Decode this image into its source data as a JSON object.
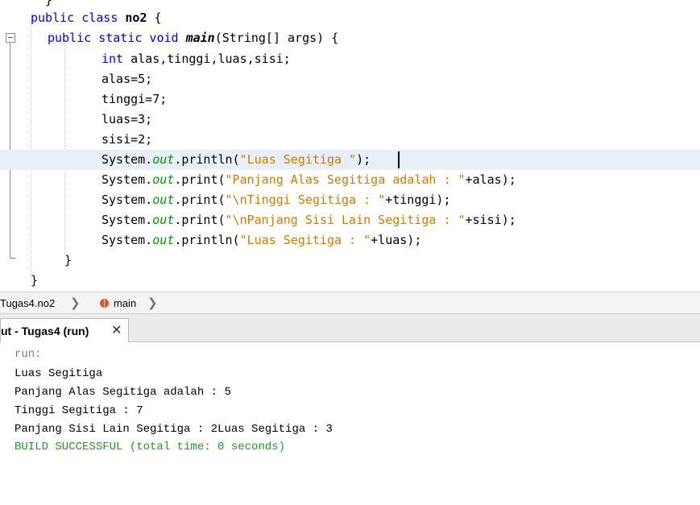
{
  "editor": {
    "lines": [
      [
        {
          "t": "  }",
          "c": ""
        }
      ],
      [
        {
          "t": "public class ",
          "c": "kw"
        },
        {
          "t": "no2",
          "c": "bold"
        },
        {
          "t": " {",
          "c": ""
        }
      ],
      [
        {
          "t": "public static void ",
          "c": "kw"
        },
        {
          "t": "main",
          "c": "mth"
        },
        {
          "t": "(String[] args) {",
          "c": ""
        }
      ],
      [
        {
          "t": "int ",
          "c": "kw"
        },
        {
          "t": "alas,tinggi,luas,sisi;",
          "c": ""
        }
      ],
      [
        {
          "t": "alas=5;",
          "c": ""
        }
      ],
      [
        {
          "t": "tinggi=7;",
          "c": ""
        }
      ],
      [
        {
          "t": "luas=3;",
          "c": ""
        }
      ],
      [
        {
          "t": "sisi=2;",
          "c": ""
        }
      ],
      [
        {
          "t": "System.",
          "c": ""
        },
        {
          "t": "out",
          "c": "fld"
        },
        {
          "t": ".println(",
          "c": ""
        },
        {
          "t": "\"Luas Segitiga \"",
          "c": "str"
        },
        {
          "t": ");",
          "c": ""
        }
      ],
      [
        {
          "t": "System.",
          "c": ""
        },
        {
          "t": "out",
          "c": "fld"
        },
        {
          "t": ".print(",
          "c": ""
        },
        {
          "t": "\"Panjang Alas Segitiga adalah : \"",
          "c": "str"
        },
        {
          "t": "+alas);",
          "c": ""
        }
      ],
      [
        {
          "t": "System.",
          "c": ""
        },
        {
          "t": "out",
          "c": "fld"
        },
        {
          "t": ".print(",
          "c": ""
        },
        {
          "t": "\"\\nTinggi Segitiga : \"",
          "c": "str"
        },
        {
          "t": "+tinggi);",
          "c": ""
        }
      ],
      [
        {
          "t": "System.",
          "c": ""
        },
        {
          "t": "out",
          "c": "fld"
        },
        {
          "t": ".print(",
          "c": ""
        },
        {
          "t": "\"\\nPanjang Sisi Lain Segitiga : \"",
          "c": "str"
        },
        {
          "t": "+sisi);",
          "c": ""
        }
      ],
      [
        {
          "t": "System.",
          "c": ""
        },
        {
          "t": "out",
          "c": "fld"
        },
        {
          "t": ".println(",
          "c": ""
        },
        {
          "t": "\"Luas Segitiga : \"",
          "c": "str"
        },
        {
          "t": "+luas);",
          "c": ""
        }
      ],
      [
        {
          "t": "}",
          "c": ""
        }
      ],
      [
        {
          "t": "}",
          "c": ""
        }
      ]
    ],
    "fold_marker": "−"
  },
  "breadcrumb": {
    "class_label": "Tugas4.no2",
    "method_label": "main",
    "separator": "❯"
  },
  "output_tab": {
    "label": "ut - Tugas4 (run)",
    "close": "✕"
  },
  "output": {
    "lines": [
      {
        "text": "run:",
        "style": "muted"
      },
      {
        "text": "Luas Segitiga",
        "style": ""
      },
      {
        "text": "Panjang Alas Segitiga adalah : 5",
        "style": ""
      },
      {
        "text": "Tinggi Segitiga : 7",
        "style": ""
      },
      {
        "text": "Panjang Sisi Lain Segitiga : 2Luas Segitiga : 3",
        "style": ""
      },
      {
        "text": "BUILD SUCCESSFUL (total time: 0 seconds)",
        "style": "success"
      }
    ]
  },
  "colors": {
    "keyword": "#0000e6",
    "string": "#ce7b00",
    "field": "#009900",
    "success": "#1f9a1f",
    "current_line": "#e9eff8"
  }
}
